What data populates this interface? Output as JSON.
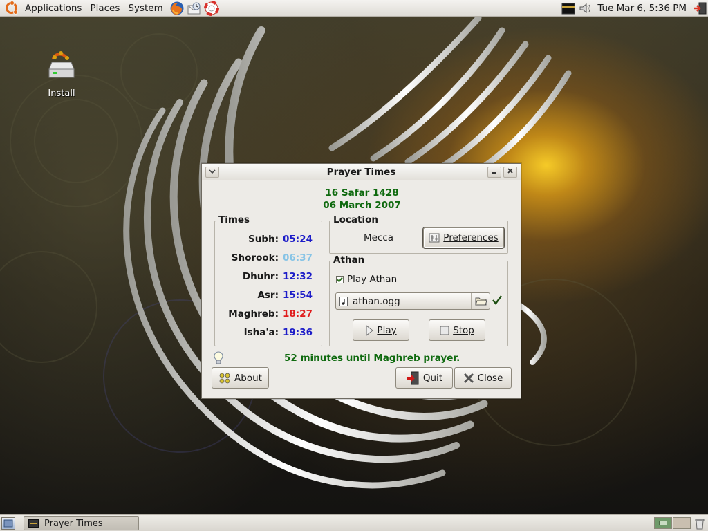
{
  "top_panel": {
    "menus": [
      "Applications",
      "Places",
      "System"
    ],
    "clock": "Tue Mar  6,  5:36 PM"
  },
  "desktop": {
    "icons": [
      {
        "label": "Install",
        "icon": "install-drive-icon"
      }
    ]
  },
  "dialog": {
    "title": "Prayer Times",
    "hijri_date": "16 Safar 1428",
    "gregorian_date": "06 March 2007",
    "times_label": "Times",
    "times": [
      {
        "name": "Subh:",
        "time": "05:24",
        "color": "#1c1cc8"
      },
      {
        "name": "Shorook:",
        "time": "06:37",
        "color": "#87c4e6"
      },
      {
        "name": "Dhuhr:",
        "time": "12:32",
        "color": "#1c1cc8"
      },
      {
        "name": "Asr:",
        "time": "15:54",
        "color": "#1c1cc8"
      },
      {
        "name": "Maghreb:",
        "time": "18:27",
        "color": "#e01c1c"
      },
      {
        "name": "Isha'a:",
        "time": "19:36",
        "color": "#1c1cc8"
      }
    ],
    "location_label": "Location",
    "location_value": "Mecca",
    "preferences_label": "Preferences",
    "athan_label": "Athan",
    "play_athan_label": "Play Athan",
    "play_athan_checked": true,
    "athan_file": "athan.ogg",
    "play_label": "Play",
    "stop_label": "Stop",
    "status_message": "52 minutes until Maghreb prayer.",
    "about_label": "About",
    "quit_label": "Quit",
    "close_label": "Close",
    "colors": {
      "date": "#0f6a0f",
      "status": "#0f6a0f"
    }
  },
  "taskbar": {
    "task_label": "Prayer Times"
  }
}
